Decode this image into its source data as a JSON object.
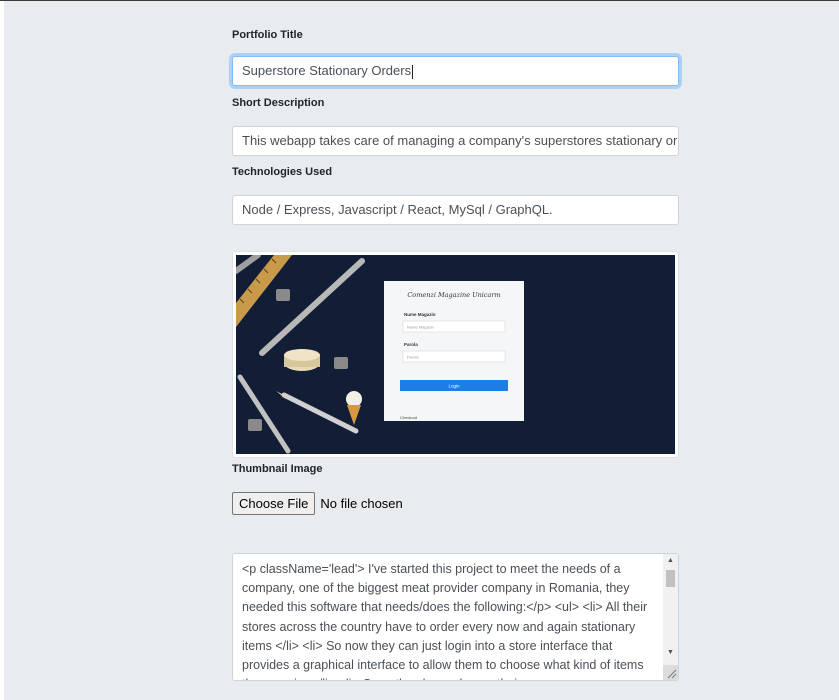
{
  "form": {
    "portfolio_title_label": "Portfolio Title",
    "portfolio_title_value": "Superstore Stationary Orders",
    "short_description_label": "Short Description",
    "short_description_value": "This webapp takes care of managing a company's superstores stationary orders.",
    "technologies_label": "Technologies Used",
    "technologies_value": "Node / Express, Javascript / React, MySql / GraphQL.",
    "thumbnail_label": "Thumbnail Image",
    "choose_file_label": "Choose File",
    "file_status": "No file chosen",
    "body_text": "<p className='lead'> I've started this project to meet the needs of a company, one of the biggest meat provider company in Romania, they needed this software that needs/does the following:</p> <ul> <li> All their stores across the country have to order every now and again stationary items </li> <li> So now they can just login into a store interface that provides a graphical interface to allow them to choose what kind of items they require </li> <li> Once they have chosen their"
  },
  "thumbnail": {
    "card_title": "Comenzi Magazine Unicarm",
    "store_name_label": "Nume Magazin",
    "store_name_placeholder": "Nume Magazin",
    "password_label": "Parola",
    "password_placeholder": "Parola",
    "login_button": "Login",
    "footer_text": "Checkout",
    "background_color": "#13213a",
    "accent_color": "#1a7fe8"
  },
  "colors": {
    "page_background": "#e9ecef",
    "focus_border": "#80bdff"
  }
}
